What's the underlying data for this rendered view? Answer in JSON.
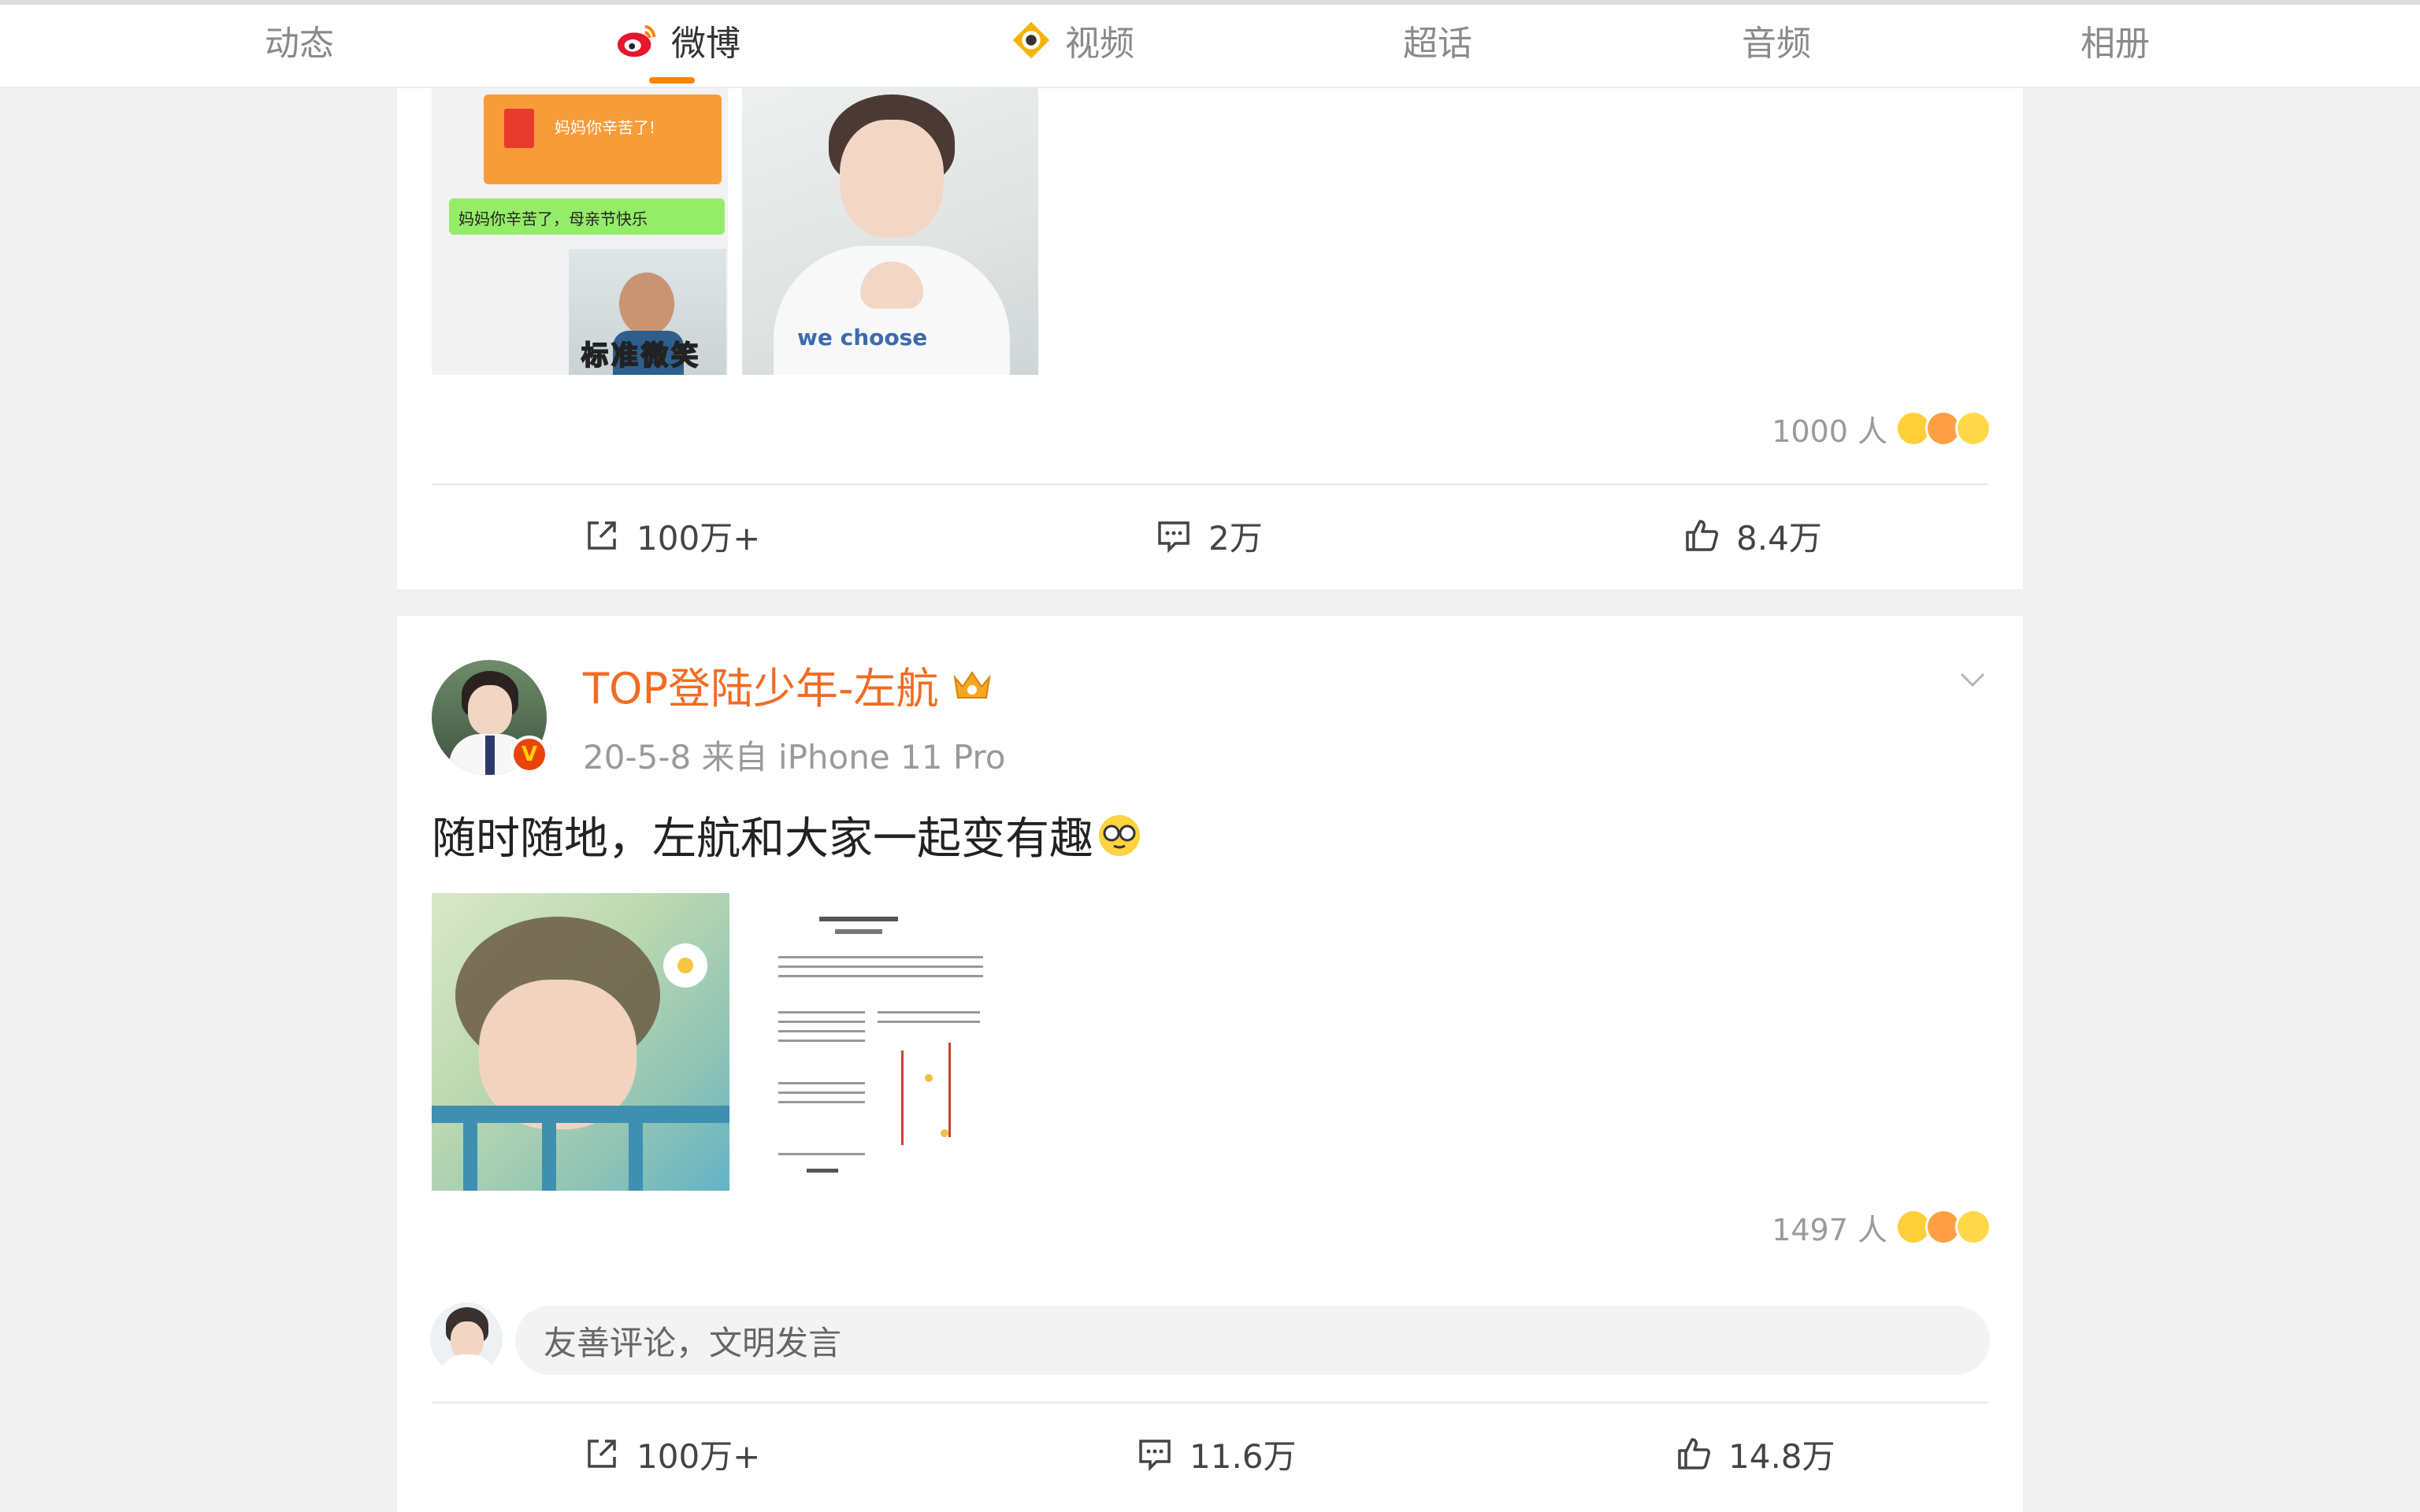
{
  "tabs": [
    {
      "label": "动态",
      "active": false
    },
    {
      "label": "微博",
      "active": true,
      "icon": "weibo-logo-icon"
    },
    {
      "label": "视频",
      "active": false,
      "icon": "video-eye-icon"
    },
    {
      "label": "超话",
      "active": false
    },
    {
      "label": "音频",
      "active": false
    },
    {
      "label": "相册",
      "active": false
    }
  ],
  "accent": "#ff8200",
  "post1": {
    "images": [
      {
        "name": "chat-screenshot-image",
        "bubble_orange": "妈妈你辛苦了!",
        "bubble_green": "妈妈你辛苦了，母亲节快乐",
        "caption": "标准微笑"
      },
      {
        "name": "boy-heart-hands-image"
      }
    ],
    "reactions": "1000 人",
    "repost": "100万+",
    "comment": "2万",
    "like": "8.4万"
  },
  "post2": {
    "username": "TOP登陆少年-左航",
    "meta": "20-5-8  来自 iPhone 11 Pro",
    "text": "随时随地，左航和大家一起变有趣",
    "images": [
      {
        "name": "boy-flower-photo"
      },
      {
        "name": "handwritten-document-image"
      }
    ],
    "reactions": "1497 人",
    "comment_placeholder": "友善评论，文明发言",
    "repost": "100万+",
    "comment": "11.6万",
    "like": "14.8万"
  }
}
